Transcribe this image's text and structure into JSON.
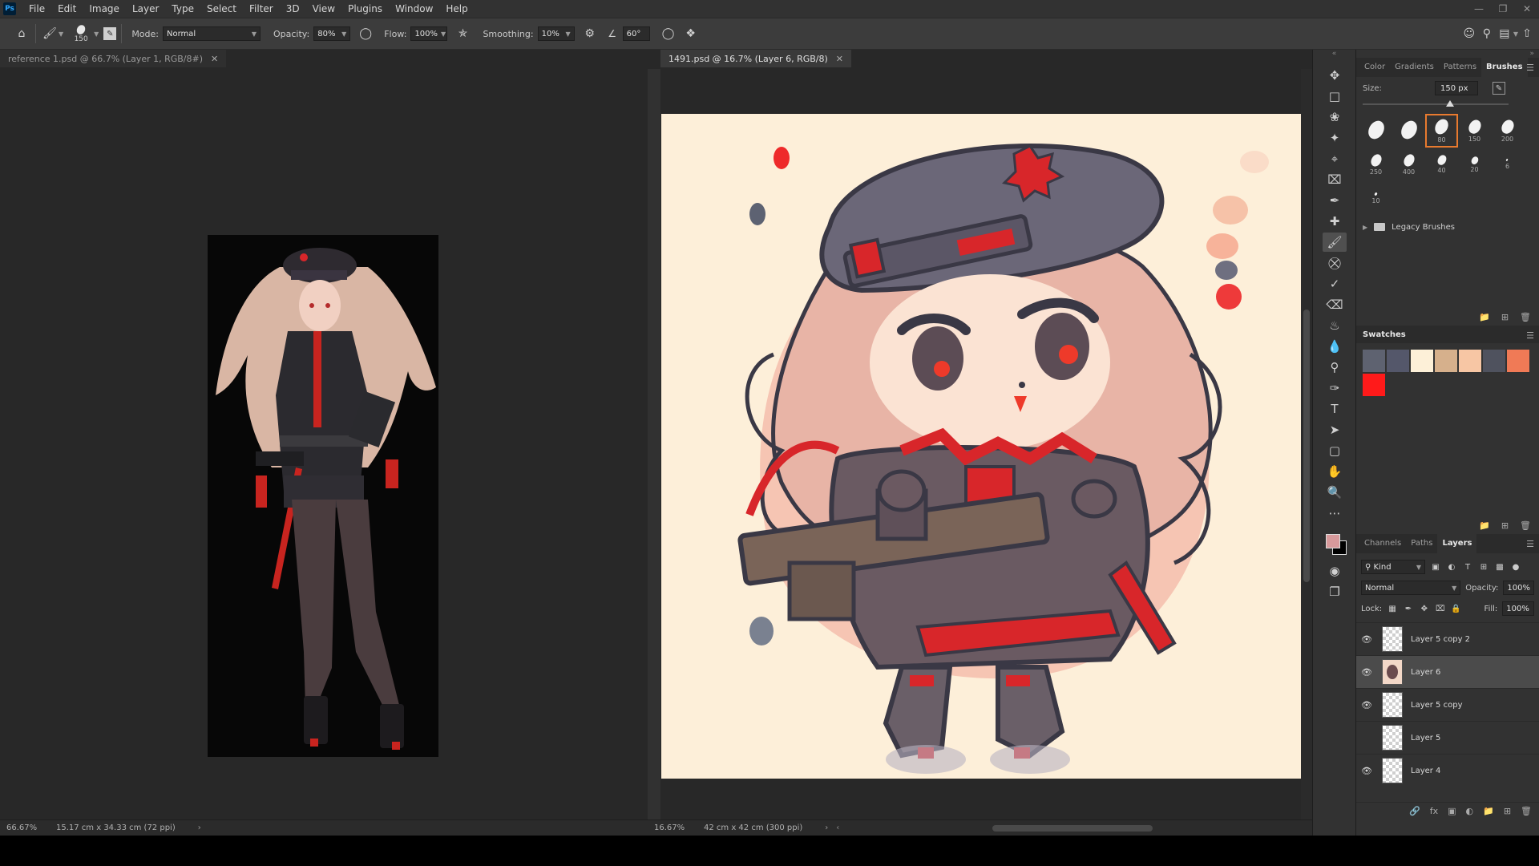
{
  "menubar": {
    "logo": "Ps",
    "items": [
      "File",
      "Edit",
      "Image",
      "Layer",
      "Type",
      "Select",
      "Filter",
      "3D",
      "View",
      "Plugins",
      "Window",
      "Help"
    ]
  },
  "options": {
    "brush_size": "150",
    "mode_label": "Mode:",
    "mode_value": "Normal",
    "opacity_label": "Opacity:",
    "opacity_value": "80%",
    "flow_label": "Flow:",
    "flow_value": "100%",
    "smoothing_label": "Smoothing:",
    "smoothing_value": "10%",
    "angle_value": "60°"
  },
  "doc_left": {
    "tab_title": "reference 1.psd @ 66.7% (Layer 1, RGB/8#)",
    "zoom": "66.67%",
    "doc_size": "15.17 cm x 34.33 cm (72 ppi)"
  },
  "doc_right": {
    "tab_title": "1491.psd @ 16.7% (Layer 6, RGB/8)",
    "zoom": "16.67%",
    "doc_size": "42 cm x 42 cm (300 ppi)"
  },
  "brushes_panel": {
    "tabs": [
      "Color",
      "Gradients",
      "Patterns",
      "Brushes"
    ],
    "active_tab": "Brushes",
    "size_label": "Size:",
    "size_value": "150 px",
    "presets": [
      {
        "size": "",
        "tip": 24
      },
      {
        "size": "",
        "tip": 24
      },
      {
        "size": "80",
        "tip": 20
      },
      {
        "size": "150",
        "tip": 18
      },
      {
        "size": "200",
        "tip": 18
      },
      {
        "size": "250",
        "tip": 16
      },
      {
        "size": "400",
        "tip": 16
      },
      {
        "size": "40",
        "tip": 13
      },
      {
        "size": "20",
        "tip": 10
      },
      {
        "size": "6",
        "tip": 3
      },
      {
        "size": "10",
        "tip": 4
      }
    ],
    "selected_preset": 2,
    "legacy_label": "Legacy Brushes"
  },
  "swatches_panel": {
    "title": "Swatches",
    "colors": [
      "#5e6270",
      "#54576a",
      "#fdf0d8",
      "#d6b08c",
      "#f7c6a4",
      "#4f525e",
      "#f07a56",
      "#ff1a1a"
    ]
  },
  "layers_panel": {
    "tabs": [
      "Channels",
      "Paths",
      "Layers"
    ],
    "active_tab": "Layers",
    "filter_label": "Kind",
    "blend_mode": "Normal",
    "opacity_label": "Opacity:",
    "opacity_value": "100%",
    "lock_label": "Lock:",
    "fill_label": "Fill:",
    "fill_value": "100%",
    "layers": [
      {
        "name": "Layer 5 copy 2",
        "visible": true,
        "selected": false,
        "art": false
      },
      {
        "name": "Layer 6",
        "visible": true,
        "selected": true,
        "art": true
      },
      {
        "name": "Layer 5 copy",
        "visible": true,
        "selected": false,
        "art": false
      },
      {
        "name": "Layer 5",
        "visible": false,
        "selected": false,
        "art": false
      },
      {
        "name": "Layer 4",
        "visible": true,
        "selected": false,
        "art": false
      }
    ]
  },
  "colors": {
    "foreground": "#d89a9c",
    "background": "#000000",
    "accent_selected": "#e87a2f"
  }
}
